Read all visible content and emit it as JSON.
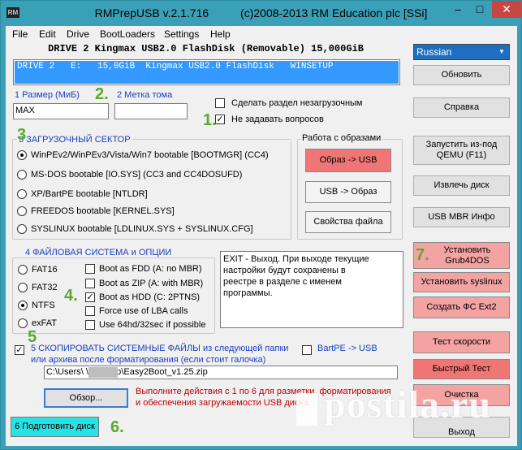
{
  "window": {
    "icon_text": "RM",
    "title": "RMPrepUSB v.2.1.716          (c)2008-2013 RM Education plc [SSi]",
    "minimize": "–",
    "maximize": "□",
    "close": "✕"
  },
  "menu": [
    "File",
    "Edit",
    "Drive",
    "BootLoaders",
    "Settings",
    "Help"
  ],
  "drive": {
    "title": "DRIVE  2 Kingmax USB2.0 FlashDisk  (Removable) 15,000GiB",
    "row": "DRIVE 2   E:   15,0GiB  Kingmax USB2.0 FlashDisk   WINSETUP"
  },
  "language": {
    "selected": "Russian",
    "arrow": "▼"
  },
  "right_buttons": {
    "refresh": "Обновить",
    "help": "Справка",
    "qemu": "Запустить из-под QEMU (F11)",
    "eject": "Извлечь диск",
    "usb_mbr": "USB MBR Инфо",
    "install_grub": "Установить Grub4DOS",
    "install_syslinux": "Установить syslinux",
    "create_ext2": "Создать ФС Ext2",
    "speed_test": "Тест скорости",
    "quick_test": "Быстрый Тест",
    "clean": "Очистка",
    "exit": "Выход"
  },
  "size": {
    "label": "1 Размер (МиБ)",
    "value": "MAX"
  },
  "volume": {
    "label": "2 Метка тома",
    "value": ""
  },
  "checkboxes_top": {
    "non_bootable": "Сделать раздел незагрузочным",
    "no_questions": "Не задавать вопросов"
  },
  "boot_sector": {
    "title": "3 ЗАГРУЗОЧНЫЙ СЕКТОР",
    "options": [
      "WinPEv2/WinPEv3/Vista/Win7 bootable [BOOTMGR] (CC4)",
      "MS-DOS bootable [IO.SYS]     (CC3 and CC4DOSUFD)",
      "XP/BartPE bootable [NTLDR]",
      "FREEDOS bootable [KERNEL.SYS]",
      "SYSLINUX bootable [LDLINUX.SYS + SYSLINUX.CFG]"
    ]
  },
  "images": {
    "title": "Работа с образами",
    "image_to_usb": "Образ -> USB",
    "usb_to_image": "USB -> Образ",
    "file_props": "Свойства файла"
  },
  "filesystem": {
    "title": "4 ФАЙЛОВАЯ СИСТЕМА и ОПЦИИ",
    "fs": [
      "FAT16",
      "FAT32",
      "NTFS",
      "exFAT"
    ],
    "options": [
      "Boot as FDD (A: no MBR)",
      "Boot as ZIP (A: with MBR)",
      "Boot as HDD (C: 2PTNS)",
      "Force use of LBA calls",
      "Use 64hd/32sec if possible"
    ]
  },
  "info_text": "EXIT - Выход. При выходе текущие\nнастройки будут сохранены в\nреестре в разделе с именем\nпрограммы.",
  "copy": {
    "line1": "5 СКОПИРОВАТЬ СИСТЕМНЫЕ ФАЙЛЫ из следующей папки",
    "line2": "или архива после форматирования (если стоит галочка)",
    "bartpe": "BartPE -> USB",
    "path": "C:\\Users\\           \\Desktop\\Easy2Boot_v1.25.zip",
    "browse": "Обзор..."
  },
  "note": "Выполните действия с 1 по 6 для разметки, форматирования\nи обеспечения загружаемости USB диска.",
  "prepare": "6 Подготовить диск",
  "step_numbers": [
    "1.",
    "2.",
    "3",
    "4.",
    "5",
    "6.",
    "7."
  ],
  "watermark": "postila.ru",
  "colors": {
    "accent": "#3aa0b8",
    "selection": "#3399ff",
    "step": "#5aa82f",
    "note": "#c00000"
  }
}
